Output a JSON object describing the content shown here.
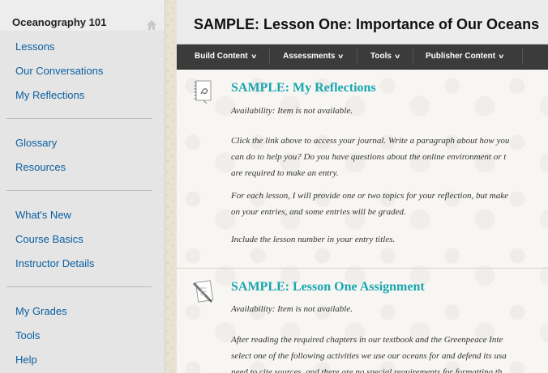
{
  "course": {
    "title": "Oceanography 101"
  },
  "sidebar": {
    "items": [
      {
        "label": "Lessons"
      },
      {
        "label": "Our Conversations"
      },
      {
        "label": "My Reflections"
      },
      {
        "label": "Glossary"
      },
      {
        "label": "Resources"
      },
      {
        "label": "What's New"
      },
      {
        "label": "Course Basics"
      },
      {
        "label": "Instructor Details"
      },
      {
        "label": "My Grades"
      },
      {
        "label": "Tools"
      },
      {
        "label": "Help"
      }
    ]
  },
  "header": {
    "title": "SAMPLE: Lesson One: Importance of Our Oceans"
  },
  "toolbar": {
    "build_content": "Build Content",
    "assessments": "Assessments",
    "tools": "Tools",
    "publisher_content": "Publisher Content"
  },
  "content": {
    "items": [
      {
        "title": "SAMPLE: My Reflections",
        "availability": "Availability:  Item is not available.",
        "paragraphs": [
          "Click the link above to access your journal. Write a paragraph about how you",
          "can do to help you? Do you have questions about the online environment or t",
          "are required to make an entry.",
          "For each lesson, I will provide one or two topics for your reflection, but make",
          "on your entries, and some entries will be graded.",
          "Include the lesson number in your entry titles."
        ]
      },
      {
        "title": "SAMPLE: Lesson One Assignment",
        "availability": "Availability:  Item is not available.",
        "paragraphs": [
          "After reading the required chapters in our textbook and the Greenpeace Inte",
          "select one of the following activities we use our oceans for and defend its usa",
          "need to cite sources, and there are no special requirements for formatting th"
        ]
      }
    ]
  },
  "colors": {
    "link": "#0a5fa0",
    "title_teal": "#1aa6b0",
    "toolbar_bg": "#3b3b3b"
  }
}
